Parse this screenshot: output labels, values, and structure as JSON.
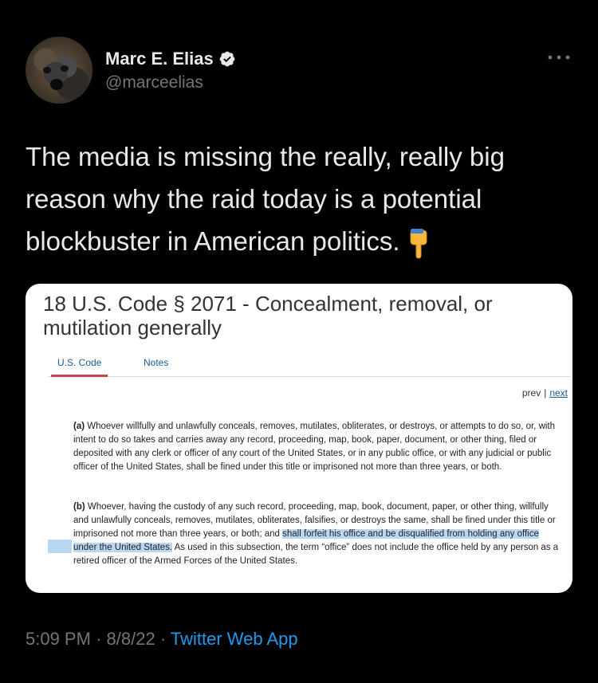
{
  "tweet": {
    "author": {
      "display_name": "Marc E. Elias",
      "handle": "@marceelias",
      "verified": true
    },
    "text": "The media is missing the really, really big reason why the raid today is a potential blockbuster in American politics.",
    "emoji": "pointing-down-hand",
    "timestamp": "5:09 PM",
    "date": "8/8/22",
    "separator": "·",
    "source": "Twitter Web App"
  },
  "card": {
    "title": "18 U.S. Code § 2071 - Concealment, removal, or mutilation generally",
    "tabs": [
      {
        "label": "U.S. Code",
        "active": true
      },
      {
        "label": "Notes",
        "active": false
      }
    ],
    "pager": {
      "prev": "prev",
      "divider": "|",
      "next": "next"
    },
    "para_a": {
      "mark": "(a)",
      "text": "Whoever willfully and unlawfully conceals, removes, mutilates, obliterates, or destroys, or attempts to do so, or, with intent to do so takes and carries away any record, proceeding, map, book, paper, document, or other thing, filed or deposited with any clerk or officer of any court of the United States, or in any public office, or with any judicial or public officer of the United States, shall be fined under this title or imprisoned not more than three years, or both."
    },
    "para_b": {
      "mark": "(b)",
      "text_before": "Whoever, having the custody of any such record, proceeding, map, book, document, paper, or other thing, willfully and unlawfully conceals, removes, mutilates, obliterates, falsifies, or destroys the same, shall be fined under this title or imprisoned not more than three years, or both; and",
      "text_highlighted": "shall forfeit his office and be disqualified from holding any office under the United States.",
      "text_after": "As used in this subsection, the term “office” does not include the office held by any person as a retired officer of the Armed Forces of the United States."
    }
  },
  "colors": {
    "background": "#000000",
    "text": "#e7e9ea",
    "muted": "#71767b",
    "link": "#1d9bf0",
    "highlight": "#b9d6f3",
    "tab_active_underline": "#c8414b"
  }
}
